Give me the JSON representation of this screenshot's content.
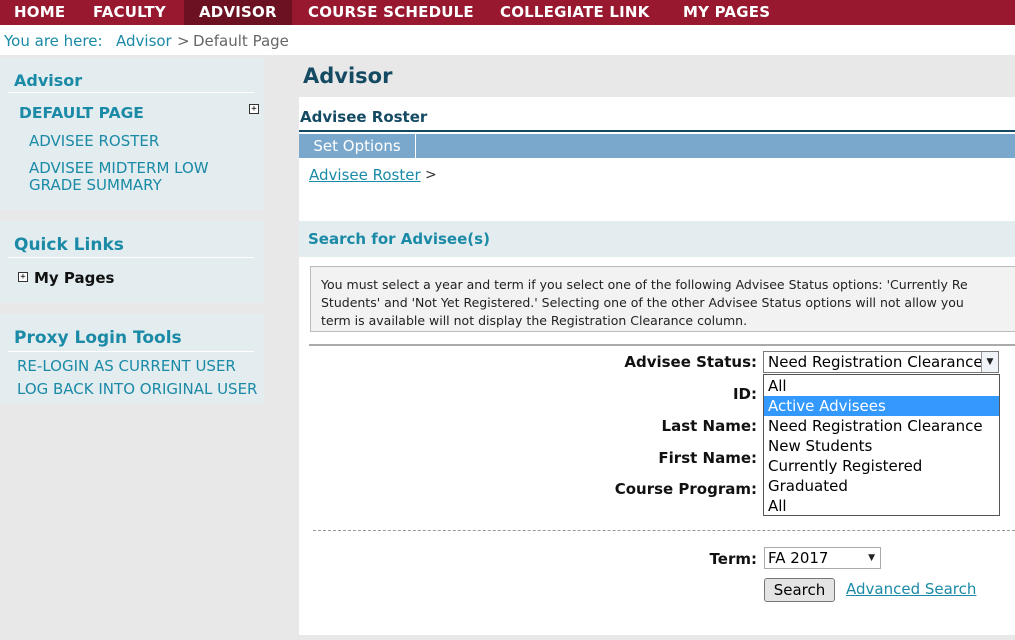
{
  "topnav": {
    "items": [
      {
        "label": "HOME"
      },
      {
        "label": "FACULTY"
      },
      {
        "label": "ADVISOR"
      },
      {
        "label": "COURSE SCHEDULE"
      },
      {
        "label": "COLLEGIATE LINK"
      },
      {
        "label": "MY PAGES"
      }
    ],
    "active": "ADVISOR"
  },
  "breadcrumb": {
    "prefix": "You are here:",
    "link": "Advisor",
    "separator": ">",
    "current": "Default Page"
  },
  "sidebar": {
    "advisor": {
      "title": "Advisor",
      "default_page": "DEFAULT PAGE",
      "items": [
        {
          "label": "ADVISEE ROSTER"
        },
        {
          "label": "ADVISEE MIDTERM LOW"
        },
        {
          "label": "GRADE SUMMARY"
        }
      ]
    },
    "quick_links": {
      "title": "Quick Links",
      "items": [
        {
          "label": "My Pages"
        }
      ]
    },
    "proxy": {
      "title": "Proxy Login Tools",
      "items": [
        {
          "label": "RE-LOGIN AS CURRENT USER"
        },
        {
          "label": "LOG BACK INTO ORIGINAL USER"
        }
      ]
    }
  },
  "main": {
    "title": "Advisor",
    "section_title": "Advisee Roster",
    "options_button": "Set Options",
    "crumb_link": "Advisee Roster",
    "crumb_sep": ">",
    "search_heading": "Search for Advisee(s)",
    "notice_lines": [
      "You must select a year and term if you select one of the following Advisee Status options: 'Currently Re",
      "Students' and 'Not Yet Registered.' Selecting one of the other Advisee Status options will not allow you",
      "term is available will not display the Registration Clearance column."
    ],
    "form": {
      "status_label": "Advisee Status:",
      "status_value": "Need Registration Clearance",
      "status_options": [
        "All",
        "Active Advisees",
        "Need Registration Clearance",
        "New Students",
        "Currently Registered",
        "Graduated",
        "All"
      ],
      "highlighted_option": "Active Advisees",
      "id_label": "ID:",
      "last_name_label": "Last Name:",
      "first_name_label": "First Name:",
      "course_program_label": "Course Program:",
      "term_label": "Term:",
      "term_value": "FA 2017",
      "search_button": "Search",
      "advanced_search": "Advanced Search"
    }
  },
  "colors": {
    "nav_bg": "#98182f",
    "nav_active": "#6b1122",
    "accent": "#1a8aa6",
    "heading": "#154a63",
    "option_bar": "#7aa8cc",
    "highlight": "#3399ff"
  }
}
